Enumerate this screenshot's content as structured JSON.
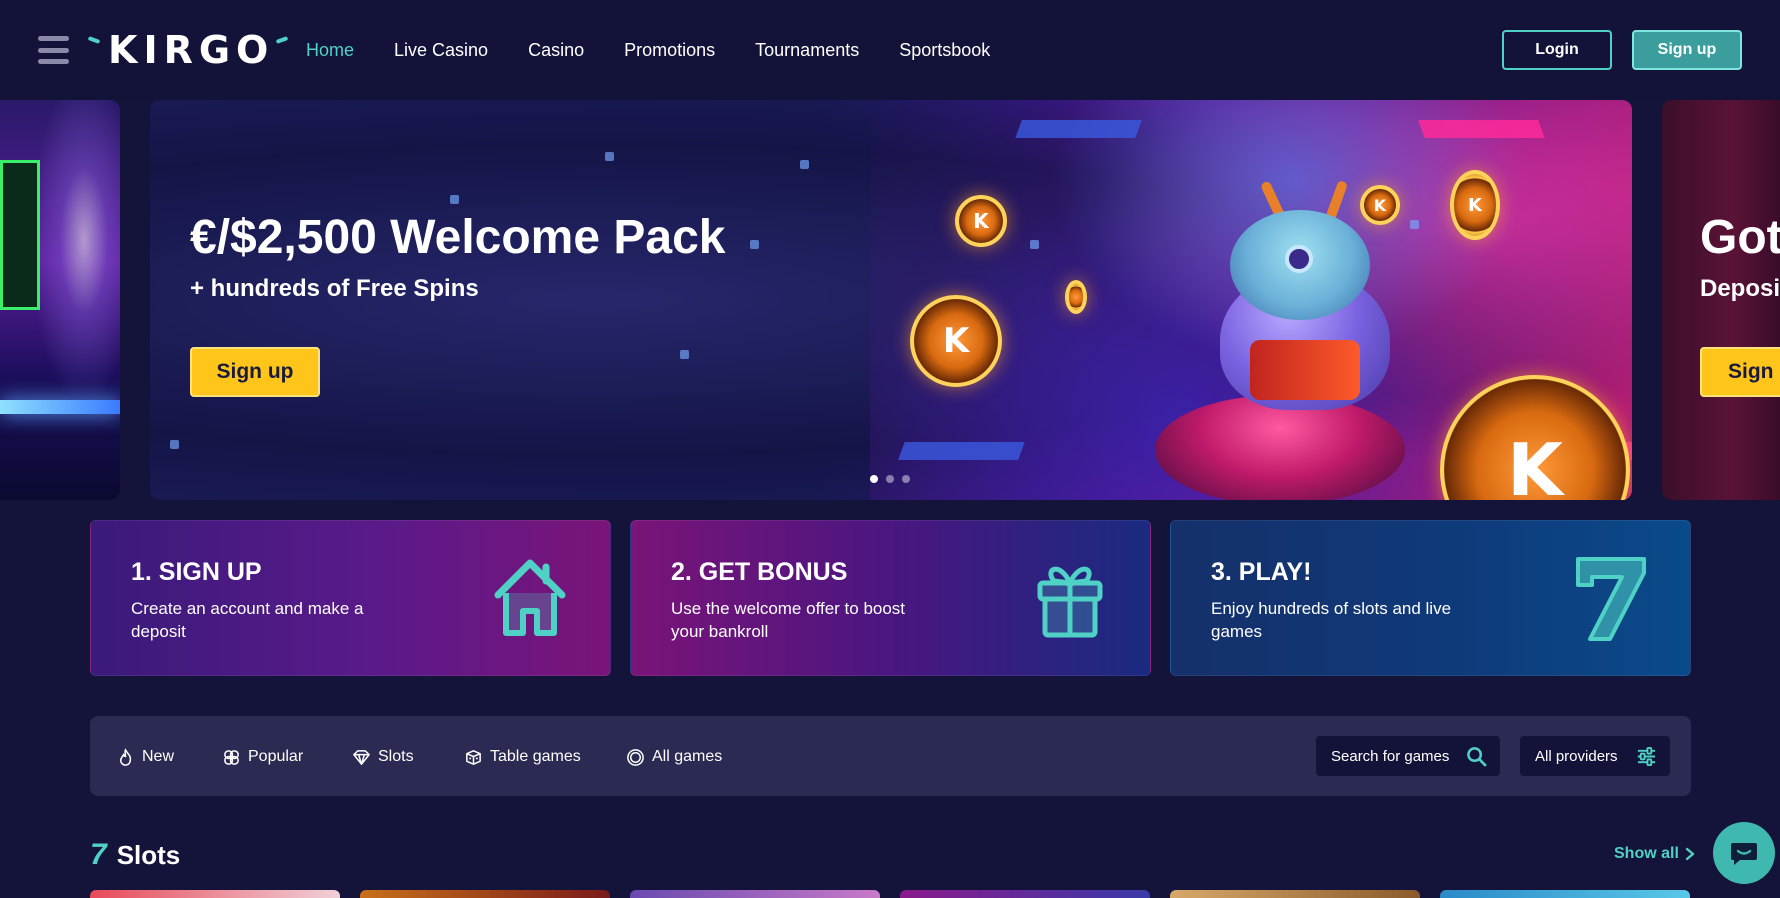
{
  "brand": {
    "logo_text": "KIRGO",
    "accent": "#4fd1c5"
  },
  "nav": {
    "items": [
      "Home",
      "Live Casino",
      "Casino",
      "Promotions",
      "Tournaments",
      "Sportsbook"
    ],
    "active": "Home"
  },
  "auth": {
    "login": "Login",
    "signup": "Sign up"
  },
  "hero": {
    "title": "€/$2,500 Welcome Pack",
    "subtitle": "+ hundreds of Free Spins",
    "cta": "Sign up",
    "slides_count": 3,
    "active_slide": 1,
    "next_peek": {
      "title": "Got",
      "subtitle": "Deposi",
      "cta": "Sign"
    },
    "coin_glyph": "K"
  },
  "steps": [
    {
      "title": "1. SIGN UP",
      "desc": "Create an account and make a deposit",
      "icon": "house-icon"
    },
    {
      "title": "2. GET BONUS",
      "desc": "Use the welcome offer to boost your bankroll",
      "icon": "gift-icon"
    },
    {
      "title": "3. PLAY!",
      "desc": "Enjoy hundreds of slots and live games",
      "icon": "seven-icon"
    }
  ],
  "filters": {
    "categories": [
      {
        "label": "New",
        "icon": "flame-icon"
      },
      {
        "label": "Popular",
        "icon": "clover-icon"
      },
      {
        "label": "Slots",
        "icon": "diamond-icon"
      },
      {
        "label": "Table games",
        "icon": "dice-icon"
      },
      {
        "label": "All games",
        "icon": "rings-icon"
      }
    ],
    "search_placeholder": "Search for games",
    "providers_label": "All providers"
  },
  "slots": {
    "icon_glyph": "7",
    "title": "Slots",
    "show_all": "Show all"
  },
  "colors": {
    "background": "#14143a",
    "accent": "#4fd1c5",
    "cta_yellow": "#ffc51a",
    "signup_button": "#3b9e9d"
  }
}
